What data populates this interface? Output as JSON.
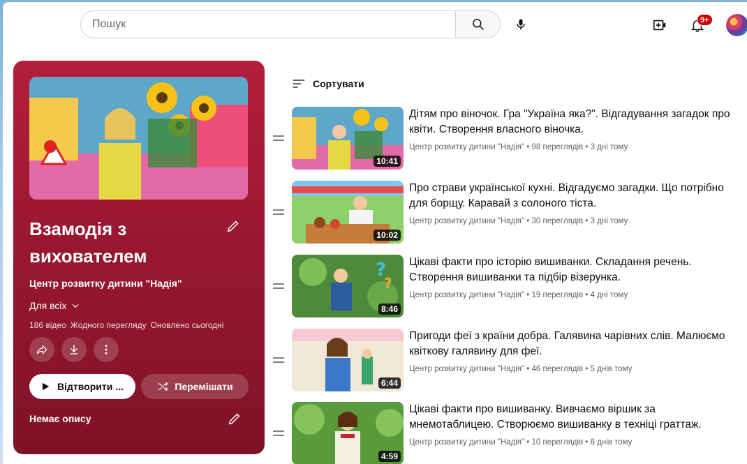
{
  "header": {
    "search_placeholder": "Пошук",
    "notification_count": "9+"
  },
  "playlist": {
    "title": "Взамодія з вихователем",
    "owner": "Центр розвитку дитини \"Надія\"",
    "visibility": "Для всіх",
    "video_count": "186 відео",
    "views": "Жодного перегляду",
    "updated": "Оновлено сьогодні",
    "play_label": "Відтворити ...",
    "shuffle_label": "Перемішати",
    "description": "Немає опису",
    "accent_color": "#a81a36"
  },
  "sort_label": "Сортувати",
  "videos": [
    {
      "title": "Дітям про віночок. Гра \"Україна яка?\". Відгадування загадок про квіти. Створення власного віночка.",
      "meta": "Центр розвитку дитини \"Надія\" • 98 переглядів • 3 дні тому",
      "duration": "10:41"
    },
    {
      "title": "Про страви української кухні. Відгадуємо загадки. Що потрібно для борщу. Каравай з солоного тіста.",
      "meta": "Центр розвитку дитини \"Надія\" • 30 переглядів • 3 дні тому",
      "duration": "10:02"
    },
    {
      "title": "Цікаві факти про історію вишиванки. Складання речень. Створення вишиванки та підбір візерунка.",
      "meta": "Центр розвитку дитини \"Надія\" • 19 переглядів • 4 дні тому",
      "duration": "8:46"
    },
    {
      "title": "Пригоди феї з країни добра. Галявина чарівних слів. Малюємо квіткову галявину для феї.",
      "meta": "Центр розвитку дитини \"Надія\" • 46 переглядів • 5 днів тому",
      "duration": "6:44"
    },
    {
      "title": "Цікаві факти про вишиванку. Вивчаємо віршик за мнемотаблицею. Створюємо вишиванку в техніці граттаж.",
      "meta": "Центр розвитку дитини \"Надія\" • 10 переглядів • 6 днів тому",
      "duration": "4:59"
    }
  ]
}
